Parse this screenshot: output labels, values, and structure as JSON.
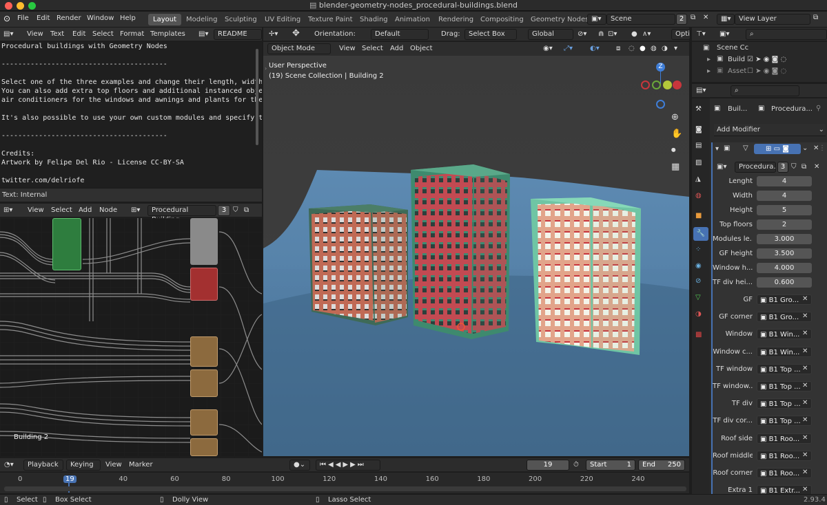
{
  "window": {
    "title": "blender-geometry-nodes_procedural-buildings.blend"
  },
  "menu": {
    "items": [
      "File",
      "Edit",
      "Render",
      "Window",
      "Help"
    ]
  },
  "workspaces": [
    "Layout",
    "Modeling",
    "Sculpting",
    "UV Editing",
    "Texture Paint",
    "Shading",
    "Animation",
    "Rendering",
    "Compositing",
    "Geometry Nodes"
  ],
  "scene": {
    "name": "Scene",
    "users": "2",
    "view_layer": "View Layer"
  },
  "text_editor": {
    "menus": [
      "View",
      "Text",
      "Edit",
      "Select",
      "Format",
      "Templates"
    ],
    "file_name": "README",
    "lines": [
      "Procedural buildings with Geometry Nodes",
      "",
      "----------------------------------------",
      "",
      "Select one of the three examples and change their length, width",
      "You can also add extra top floors and additional instanced obje",
      "air conditioners for the windows and awnings and plants for the",
      "",
      "It's also possible to use your own custom modules and specify t",
      "",
      "----------------------------------------",
      "",
      "Credits:",
      "Artwork by Felipe Del Rio - License CC-BY-SA",
      "",
      "twitter.com/delriofe"
    ],
    "footer": "Text: Internal"
  },
  "node_editor": {
    "menus": [
      "View",
      "Select",
      "Add",
      "Node"
    ],
    "tree_name": "Procedural Building",
    "users": "3",
    "object_label": "Building 2"
  },
  "viewport": {
    "header1": {
      "orientation_label": "Orientation:",
      "orientation": "Default",
      "drag_label": "Drag:",
      "drag": "Select Box",
      "transform": "Global",
      "options": "Optio"
    },
    "header2": {
      "mode": "Object Mode",
      "menus": [
        "View",
        "Select",
        "Add",
        "Object"
      ]
    },
    "perspective": "User Perspective",
    "collection": "(19) Scene Collection | Building 2",
    "gizmo": {
      "z": "Z"
    }
  },
  "outliner": {
    "rows": [
      {
        "label": "Scene Cc"
      },
      {
        "label": "Build"
      },
      {
        "label": "Asset"
      }
    ]
  },
  "properties": {
    "object_name": "Buil...",
    "modifier_name": "Procedura...",
    "add_modifier": "Add Modifier",
    "node_group": "Procedura...",
    "node_users": "3",
    "numeric": [
      {
        "label": "Lenght",
        "value": "4"
      },
      {
        "label": "Width",
        "value": "4"
      },
      {
        "label": "Height",
        "value": "5"
      },
      {
        "label": "Top floors",
        "value": "2"
      },
      {
        "label": "Modules le...",
        "value": "3.000"
      },
      {
        "label": "GF height",
        "value": "3.500"
      },
      {
        "label": "Window h...",
        "value": "4.000"
      },
      {
        "label": "TF div hei...",
        "value": "0.600"
      }
    ],
    "objects": [
      {
        "label": "GF",
        "value": "B1 Gro..."
      },
      {
        "label": "GF corner",
        "value": "B1 Gro..."
      },
      {
        "label": "Window",
        "value": "B1 Win..."
      },
      {
        "label": "Window c...",
        "value": "B1 Win..."
      },
      {
        "label": "TF window",
        "value": "B1 Top ..."
      },
      {
        "label": "TF window...",
        "value": "B1 Top ..."
      },
      {
        "label": "TF div",
        "value": "B1 Top ..."
      },
      {
        "label": "TF div cor...",
        "value": "B1 Top ..."
      },
      {
        "label": "Roof side",
        "value": "B1 Roo..."
      },
      {
        "label": "Roof middle",
        "value": "B1 Roo..."
      },
      {
        "label": "Roof corner",
        "value": "B1 Roo..."
      },
      {
        "label": "Extra 1",
        "value": "B1 Extr..."
      }
    ]
  },
  "timeline": {
    "menus": [
      "Playback",
      "Keying",
      "View",
      "Marker"
    ],
    "current_frame": "19",
    "start_label": "Start",
    "start": "1",
    "end_label": "End",
    "end": "250",
    "ticks": [
      "0",
      "19",
      "40",
      "60",
      "80",
      "100",
      "120",
      "140",
      "160",
      "180",
      "200",
      "220",
      "240"
    ]
  },
  "statusbar": {
    "select": "Select",
    "box_select": "Box Select",
    "dolly": "Dolly View",
    "lasso": "Lasso Select",
    "version": "2.93.4"
  },
  "colors": {
    "accent": "#4772b3",
    "active_tab": "#545454",
    "panel_bg": "#303030"
  }
}
